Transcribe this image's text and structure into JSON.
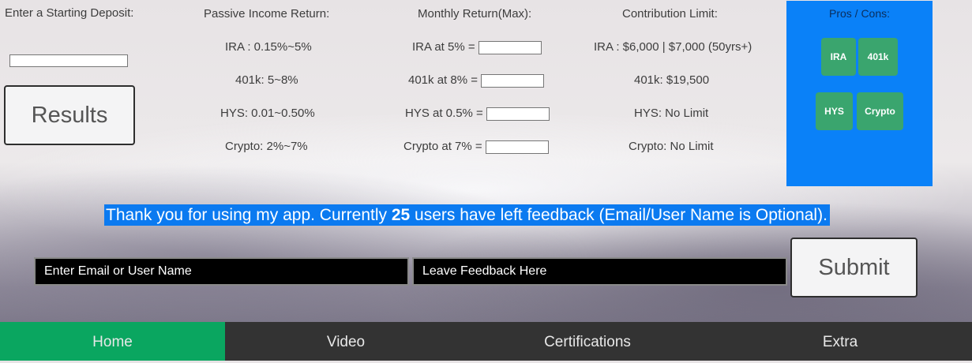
{
  "deposit": {
    "label": "Enter a Starting Deposit:",
    "value": "",
    "results_label": "Results"
  },
  "passive": {
    "title": "Passive Income Return:",
    "rows": [
      "IRA : 0.15%~5%",
      "401k: 5~8%",
      "HYS: 0.01~0.50%",
      "Crypto: 2%~7%"
    ]
  },
  "monthly": {
    "title": "Monthly Return(Max):",
    "rows": [
      "IRA at 5% =",
      "401k at 8% =",
      "HYS at 0.5% =",
      "Crypto at 7% ="
    ]
  },
  "contribution": {
    "title": "Contribution Limit:",
    "rows": [
      "IRA : $6,000 | $7,000 (50yrs+)",
      "401k: $19,500",
      "HYS: No Limit",
      "Crypto: No Limit"
    ]
  },
  "pros_cons": {
    "title": "Pros / Cons:",
    "buttons": [
      "IRA",
      "401k",
      "HYS",
      "Crypto"
    ],
    "panel_color": "#0a81f8",
    "button_color": "#3aa56e"
  },
  "feedback": {
    "message_before": "Thank you for using my app. Currently ",
    "count": "25",
    "message_after": " users have left feedback (Email/User Name is Optional).",
    "email_placeholder": "Enter Email or User Name",
    "feedback_placeholder": "Leave Feedback Here",
    "submit_label": "Submit"
  },
  "nav": {
    "items": [
      "Home",
      "Video",
      "Certifications",
      "Extra"
    ],
    "active": "Home",
    "active_color": "#0aa660"
  }
}
